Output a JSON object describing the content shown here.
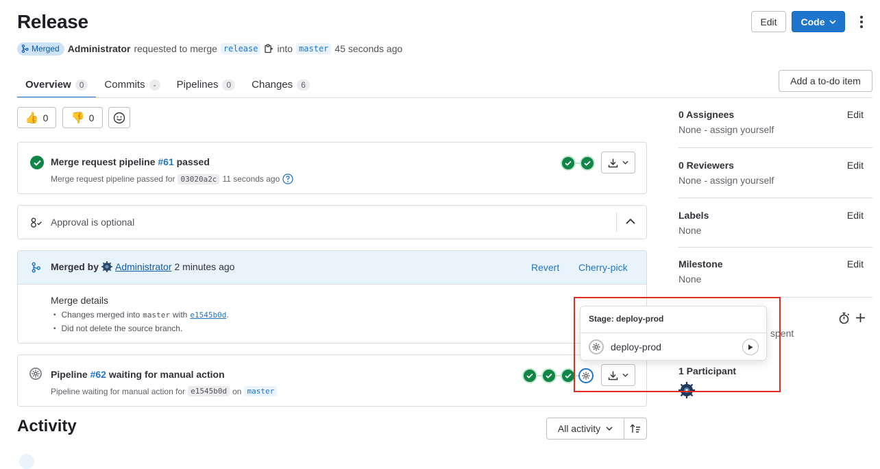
{
  "header": {
    "title": "Release",
    "status_badge": "Merged",
    "author": "Administrator",
    "requested_text": "requested to merge",
    "source_branch": "release",
    "into_text": "into",
    "target_branch": "master",
    "time": "45 seconds ago",
    "edit_label": "Edit",
    "code_label": "Code"
  },
  "tabs": [
    {
      "label": "Overview",
      "count": "0"
    },
    {
      "label": "Commits",
      "count": "-"
    },
    {
      "label": "Pipelines",
      "count": "0"
    },
    {
      "label": "Changes",
      "count": "6"
    }
  ],
  "todo_label": "Add a to-do item",
  "reactions": {
    "thumbs_up": "0",
    "thumbs_down": "0"
  },
  "pipeline1": {
    "title_prefix": "Merge request pipeline",
    "id": "#61",
    "status": "passed",
    "sub_prefix": "Merge request pipeline passed for",
    "sha": "03020a2c",
    "time": "11 seconds ago"
  },
  "approval": {
    "text": "Approval is optional"
  },
  "merged": {
    "label": "Merged by",
    "user": "Administrator",
    "time": "2 minutes ago",
    "revert": "Revert",
    "cherry_pick": "Cherry-pick",
    "details_title": "Merge details",
    "line1_prefix": "Changes merged into",
    "line1_branch": "master",
    "line1_with": "with",
    "line1_sha": "e1545b0d",
    "line1_end": ".",
    "line2": "Did not delete the source branch."
  },
  "pipeline2": {
    "title_prefix": "Pipeline",
    "id": "#62",
    "status": "waiting for manual action",
    "sub_prefix": "Pipeline waiting for manual action for",
    "sha": "e1545b0d",
    "on": "on",
    "branch": "master"
  },
  "activity": {
    "title": "Activity",
    "filter": "All activity"
  },
  "sidebar": {
    "edit_label": "Edit",
    "assignees": {
      "label": "0 Assignees",
      "value": "None - assign yourself"
    },
    "reviewers": {
      "label": "0 Reviewers",
      "value": "None - assign yourself"
    },
    "labels": {
      "label": "Labels",
      "value": "None"
    },
    "milestone": {
      "label": "Milestone",
      "value": "None"
    },
    "time_spent_fragment": "spent",
    "participants": {
      "label": "1 Participant"
    }
  },
  "popover": {
    "stage_label": "Stage: deploy-prod",
    "job": "deploy-prod"
  },
  "colors": {
    "accent": "#1f75cb",
    "success": "#108548",
    "highlight": "#e5291f"
  }
}
